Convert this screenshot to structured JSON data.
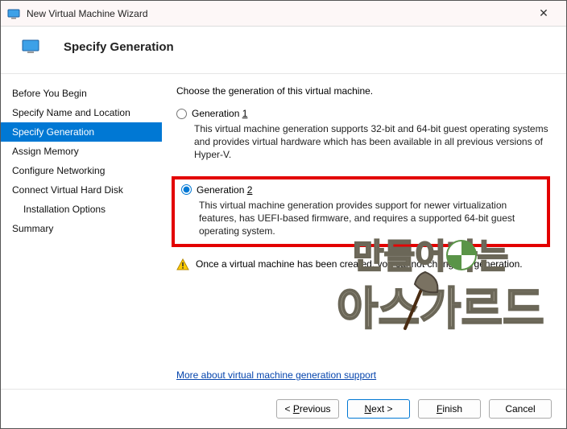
{
  "window": {
    "title": "New Virtual Machine Wizard"
  },
  "header": {
    "title": "Specify Generation"
  },
  "sidebar": {
    "items": [
      {
        "label": "Before You Begin"
      },
      {
        "label": "Specify Name and Location"
      },
      {
        "label": "Specify Generation"
      },
      {
        "label": "Assign Memory"
      },
      {
        "label": "Configure Networking"
      },
      {
        "label": "Connect Virtual Hard Disk"
      },
      {
        "label": "Installation Options"
      },
      {
        "label": "Summary"
      }
    ]
  },
  "content": {
    "prompt": "Choose the generation of this virtual machine.",
    "gen1": {
      "label_pre": "Generation ",
      "label_key": "1",
      "desc": "This virtual machine generation supports 32-bit and 64-bit guest operating systems and provides virtual hardware which has been available in all previous versions of Hyper-V."
    },
    "gen2": {
      "label_pre": "Generation ",
      "label_key": "2",
      "desc": "This virtual machine generation provides support for newer virtualization features, has UEFI-based firmware, and requires a supported 64-bit guest operating system."
    },
    "warning": "Once a virtual machine has been created, you cannot change its generation.",
    "link": "More about virtual machine generation support"
  },
  "footer": {
    "previous_pre": "< ",
    "previous_key": "P",
    "previous_post": "revious",
    "next_key": "N",
    "next_post": "ext >",
    "finish_key": "F",
    "finish_post": "inish",
    "cancel": "Cancel"
  }
}
